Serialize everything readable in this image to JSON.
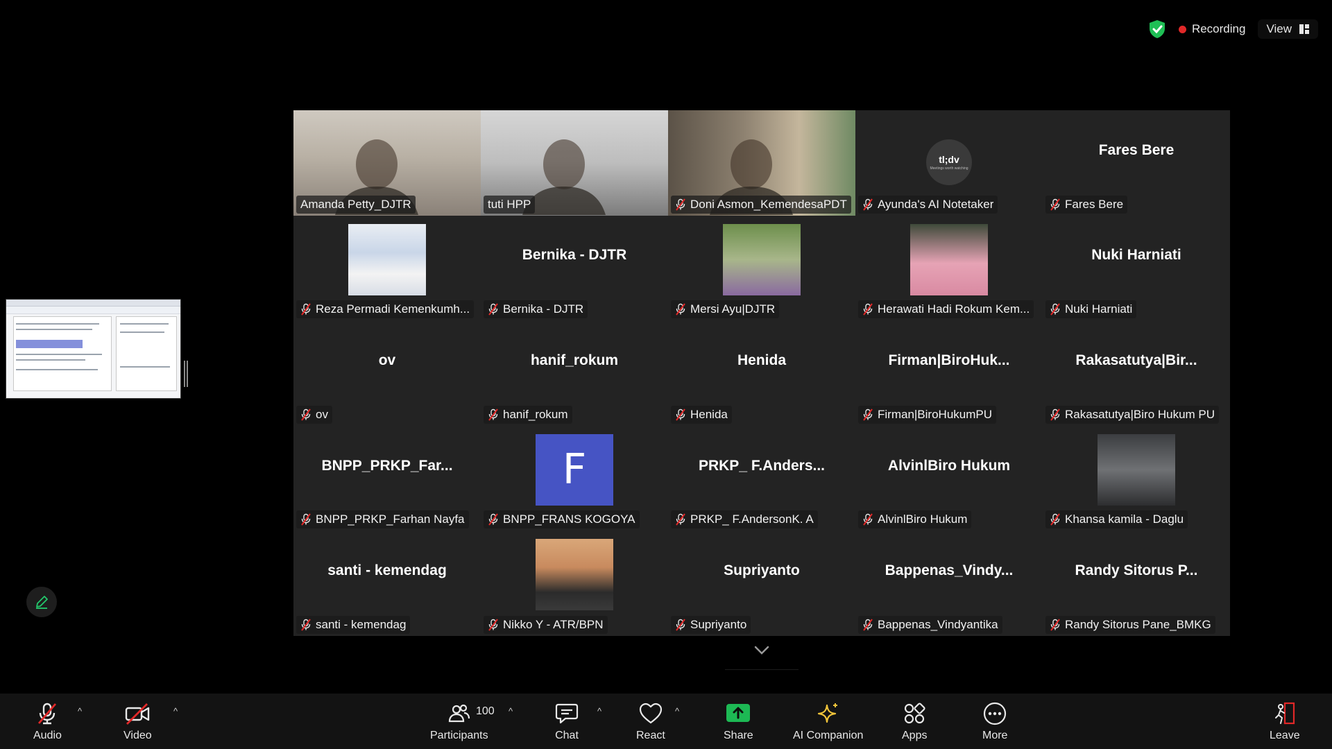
{
  "status": {
    "recording_label": "Recording",
    "view_label": "View"
  },
  "participants": [
    {
      "display": "video",
      "name": "Amanda Petty_DJTR",
      "muted": false,
      "speaking": true
    },
    {
      "display": "video",
      "name": "tuti HPP",
      "muted": false
    },
    {
      "display": "video",
      "name": "Doni Asmon_KemendesaPDT",
      "muted": true
    },
    {
      "display": "logo",
      "name": "Ayunda's AI Notetaker",
      "muted": true,
      "logo_text": "tl;dv",
      "logo_sub": "Meetings worth watching"
    },
    {
      "display": "name",
      "name": "Fares Bere",
      "center_name": "Fares Bere",
      "muted": true
    },
    {
      "display": "photo",
      "name": "Reza Permadi Kemenkumh...",
      "muted": true
    },
    {
      "display": "name",
      "name": "Bernika - DJTR",
      "center_name": "Bernika - DJTR",
      "muted": true
    },
    {
      "display": "photo",
      "name": "Mersi Ayu|DJTR",
      "muted": true
    },
    {
      "display": "photo",
      "name": "Herawati Hadi Rokum Kem...",
      "muted": true
    },
    {
      "display": "name",
      "name": "Nuki Harniati",
      "center_name": "Nuki Harniati",
      "muted": true
    },
    {
      "display": "name",
      "name": "ov",
      "center_name": "ov",
      "muted": true
    },
    {
      "display": "name",
      "name": "hanif_rokum",
      "center_name": "hanif_rokum",
      "muted": true
    },
    {
      "display": "name",
      "name": "Henida",
      "center_name": "Henida",
      "muted": true
    },
    {
      "display": "name",
      "name": "Firman|BiroHukumPU",
      "center_name": "Firman|BiroHuk...",
      "muted": true
    },
    {
      "display": "name",
      "name": "Rakasatutya|Biro Hukum PU",
      "center_name": "Rakasatutya|Bir...",
      "muted": true
    },
    {
      "display": "name",
      "name": "BNPP_PRKP_Farhan Nayfa",
      "center_name": "BNPP_PRKP_Far...",
      "muted": true
    },
    {
      "display": "letter",
      "name": "BNPP_FRANS KOGOYA",
      "letter": "F",
      "muted": true
    },
    {
      "display": "name",
      "name": "PRKP_ F.AndersonK. A",
      "center_name": "PRKP_ F.Anders...",
      "muted": true
    },
    {
      "display": "name",
      "name": "AlvinlBiro Hukum",
      "center_name": "AlvinlBiro Hukum",
      "muted": true
    },
    {
      "display": "photo",
      "name": "Khansa kamila - Daglu",
      "muted": true
    },
    {
      "display": "name",
      "name": "santi - kemendag",
      "center_name": "santi - kemendag",
      "muted": true
    },
    {
      "display": "photo",
      "name": "Nikko Y - ATR/BPN",
      "muted": true
    },
    {
      "display": "name",
      "name": "Supriyanto",
      "center_name": "Supriyanto",
      "muted": true
    },
    {
      "display": "name",
      "name": "Bappenas_Vindyantika",
      "center_name": "Bappenas_Vindy...",
      "muted": true
    },
    {
      "display": "name",
      "name": "Randy Sitorus Pane_BMKG",
      "center_name": "Randy Sitorus P...",
      "muted": true
    }
  ],
  "toolbar": {
    "audio": "Audio",
    "video": "Video",
    "participants": "Participants",
    "participant_count": "100",
    "chat": "Chat",
    "react": "React",
    "share": "Share",
    "ai_companion": "AI Companion",
    "apps": "Apps",
    "more": "More",
    "leave": "Leave"
  },
  "colors": {
    "speaking_border": "#23d96c",
    "recording_dot": "#e02828",
    "share_green": "#1db954",
    "leave_red": "#e02828",
    "letter_avatar": "#4654c4",
    "tile_bg": "#232323"
  }
}
